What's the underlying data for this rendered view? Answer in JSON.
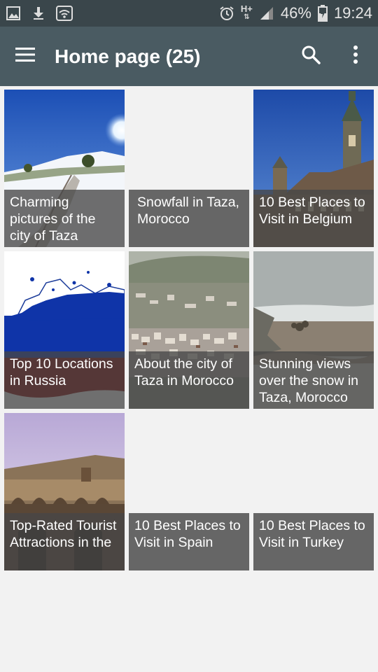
{
  "status_bar": {
    "left_icons": [
      "image-icon",
      "download-icon",
      "wifi-icon"
    ],
    "right_icons": [
      "alarm-icon",
      "network-hplus-icon",
      "signal-icon",
      "battery-icon"
    ],
    "network_label": "H+",
    "battery_percent": "46%",
    "time": "19:24"
  },
  "app_bar": {
    "title": "Home page (25)",
    "icons": [
      "menu-icon",
      "search-icon",
      "more-vert-icon"
    ]
  },
  "articles": [
    {
      "title": "Charming pictures of the city of Taza"
    },
    {
      "title": "Snowfall in Taza, Morocco"
    },
    {
      "title": "10 Best Places to Visit in Belgium"
    },
    {
      "title": "Top 10 Locations in Russia"
    },
    {
      "title": "About the city of Taza in Morocco"
    },
    {
      "title": "Stunning views over the snow in Taza, Morocco"
    },
    {
      "title": "Top-Rated Tourist Attractions in the"
    },
    {
      "title": "10 Best Places to Visit in Spain"
    },
    {
      "title": "10 Best Places to Visit in Turkey"
    }
  ]
}
